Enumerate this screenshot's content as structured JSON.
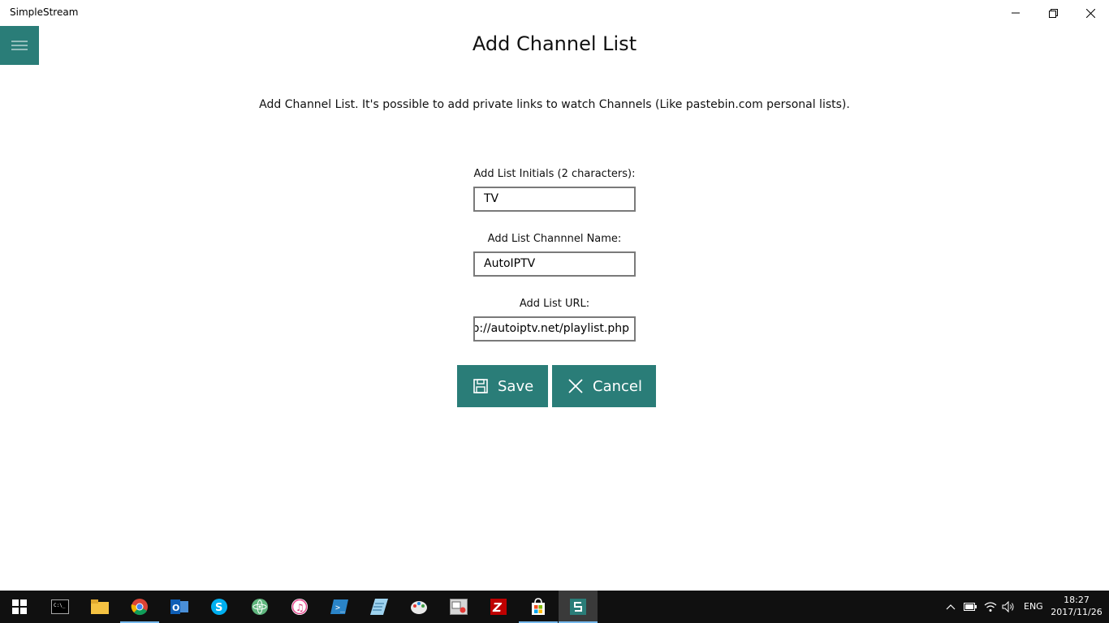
{
  "window": {
    "title": "SimpleStream"
  },
  "page": {
    "title": "Add Channel List",
    "description": "Add Channel List. It's possible to add private links to watch Channels (Like pastebin.com personal lists)."
  },
  "form": {
    "initials_label": "Add List Initials (2 characters):",
    "initials_value": "TV",
    "name_label": "Add List Channnel Name:",
    "name_value": "AutoIPTV",
    "url_label": "Add List URL:",
    "url_value": "http://autoiptv.net/playlist.php"
  },
  "buttons": {
    "save": "Save",
    "cancel": "Cancel"
  },
  "taskbar": {
    "apps": [
      "start-icon",
      "terminal-icon",
      "file-explorer-icon",
      "chrome-icon",
      "outlook-icon",
      "skype-icon",
      "atom-icon",
      "itunes-icon",
      "powershell-icon",
      "notepad-icon",
      "paint-icon",
      "screen-capture-icon",
      "filezilla-icon",
      "store-icon",
      "simplestream-icon"
    ],
    "language": "ENG",
    "time": "18:27",
    "date": "2017/11/26"
  },
  "colors": {
    "accent": "#2a7d78",
    "taskbar": "#101010"
  }
}
